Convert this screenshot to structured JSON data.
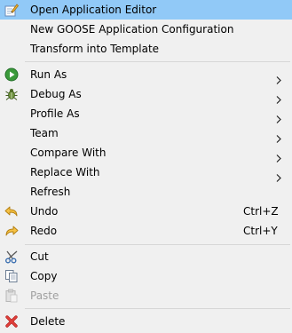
{
  "menu": {
    "items": [
      {
        "label": "Open Application Editor"
      },
      {
        "label": "New GOOSE Application Configuration"
      },
      {
        "label": "Transform into Template"
      },
      {
        "label": "Run As"
      },
      {
        "label": "Debug As"
      },
      {
        "label": "Profile As"
      },
      {
        "label": "Team"
      },
      {
        "label": "Compare With"
      },
      {
        "label": "Replace With"
      },
      {
        "label": "Refresh"
      },
      {
        "label": "Undo",
        "shortcut": "Ctrl+Z"
      },
      {
        "label": "Redo",
        "shortcut": "Ctrl+Y"
      },
      {
        "label": "Cut"
      },
      {
        "label": "Copy"
      },
      {
        "label": "Paste"
      },
      {
        "label": "Delete"
      }
    ]
  },
  "colors": {
    "background": "#f0f0f0",
    "highlight": "#91c9f7",
    "separator": "#d7d7d7",
    "disabled_text": "#a0a0a0"
  },
  "icons": {
    "open_editor": "pencil-editor-icon",
    "run": "run-play-icon",
    "debug": "debug-bug-icon",
    "undo": "undo-arrow-icon",
    "redo": "redo-arrow-icon",
    "cut": "scissors-icon",
    "copy": "copy-icon",
    "paste": "paste-clipboard-icon",
    "delete": "delete-x-icon"
  }
}
